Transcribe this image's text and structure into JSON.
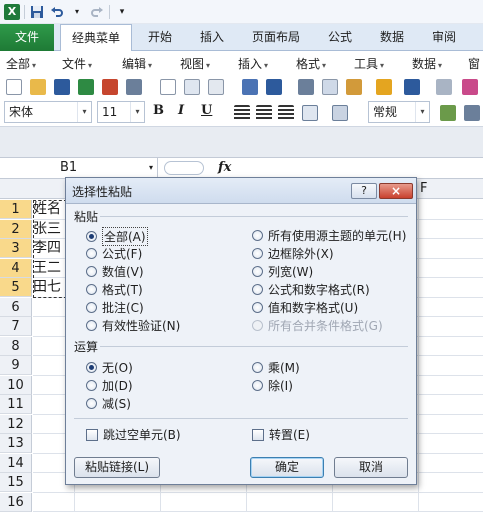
{
  "quick_access": {
    "app_icon_letter": "X",
    "icons": [
      "save-icon",
      "undo-icon",
      "redo-icon",
      "customize-icon"
    ]
  },
  "ribbon": {
    "tabs": [
      "文件",
      "经典菜单",
      "开始",
      "插入",
      "页面布局",
      "公式",
      "数据",
      "审阅"
    ]
  },
  "menu_row": {
    "items": [
      "全部",
      "文件",
      "编辑",
      "视图",
      "插入",
      "格式",
      "工具",
      "数据",
      "窗"
    ]
  },
  "toolbar2": {
    "font_name": "宋体",
    "font_size": "11",
    "bold": "B",
    "italic": "I",
    "underline": "U",
    "number_format": "常规"
  },
  "formula_bar": {
    "name_box": "B1",
    "fx_label": "fx"
  },
  "grid": {
    "visible_column_header": "F",
    "row_numbers": [
      "1",
      "2",
      "3",
      "4",
      "5",
      "6",
      "7",
      "8",
      "9",
      "10",
      "11",
      "12",
      "13",
      "14",
      "15",
      "16"
    ],
    "cells": [
      "姓名",
      "张三",
      "李四",
      "王二",
      "田七"
    ]
  },
  "dialog": {
    "title": "选择性粘贴",
    "help_glyph": "?",
    "close_glyph": "×",
    "paste_section": "粘贴",
    "paste_left": [
      "全部(A)",
      "公式(F)",
      "数值(V)",
      "格式(T)",
      "批注(C)",
      "有效性验证(N)"
    ],
    "paste_right": [
      "所有使用源主题的单元(H)",
      "边框除外(X)",
      "列宽(W)",
      "公式和数字格式(R)",
      "值和数字格式(U)",
      "所有合并条件格式(G)"
    ],
    "operation_section": "运算",
    "op_left": [
      "无(O)",
      "加(D)",
      "减(S)"
    ],
    "op_right": [
      "乘(M)",
      "除(I)"
    ],
    "skip_blanks": "跳过空单元(B)",
    "transpose": "转置(E)",
    "paste_link_button": "粘贴链接(L)",
    "ok_button": "确定",
    "cancel_button": "取消"
  }
}
